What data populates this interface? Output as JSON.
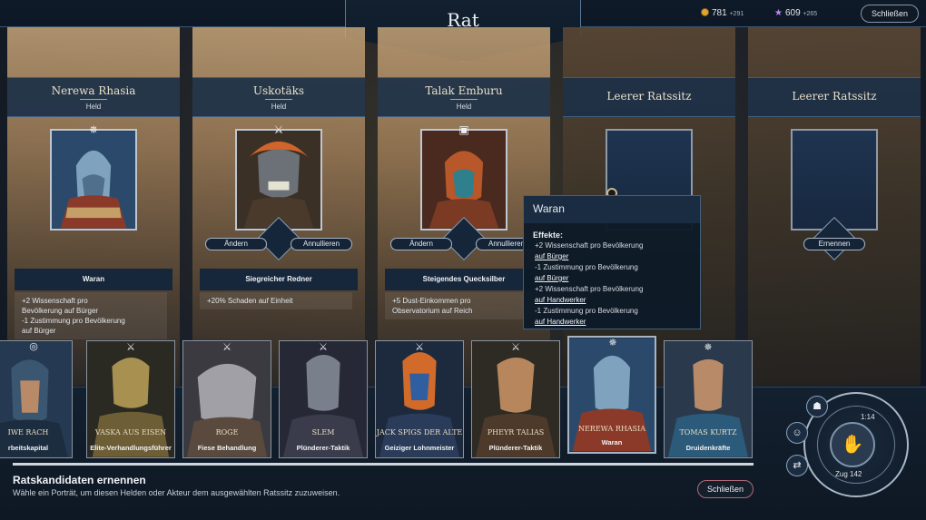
{
  "title": "Rat",
  "resources": {
    "gold": "781",
    "gold_delta": "+291",
    "influence": "609",
    "influence_delta": "+265",
    "close_label": "Schließen"
  },
  "council": [
    {
      "name": "Nerewa Rhasia",
      "subtitle": "Held",
      "ability": "Waran",
      "buttons": [],
      "effect": [
        "+2 Wissenschaft pro",
        "Bevölkerung auf Bürger",
        "-1 Zustimmung pro Bevölkerung",
        "auf Bürger"
      ]
    },
    {
      "name": "Uskotäks",
      "subtitle": "Held",
      "ability": "Siegreicher Redner",
      "buttons": [
        "Ändern",
        "Annullieren"
      ],
      "effect": [
        "+20% Schaden auf Einheit"
      ]
    },
    {
      "name": "Talak Emburu",
      "subtitle": "Held",
      "ability": "Steigendes Quecksilber",
      "buttons": [
        "Ändern",
        "Annullieren"
      ],
      "effect": [
        "+5 Dust-Einkommen pro",
        "Observatorium auf Reich"
      ]
    },
    {
      "name": "Leerer Ratssitz",
      "subtitle": "",
      "ability": "",
      "buttons": [],
      "effect": []
    },
    {
      "name": "Leerer Ratssitz",
      "subtitle": "",
      "ability": "",
      "buttons": [
        "Ernennen"
      ],
      "effect": []
    }
  ],
  "tooltip": {
    "title": "Waran",
    "effects_label": "Effekte:",
    "lines": [
      "+2 Wissenschaft pro Bevölkerung",
      "auf Bürger",
      "-1 Zustimmung pro Bevölkerung",
      "auf Bürger",
      "+2 Wissenschaft pro Bevölkerung",
      "auf Handwerker",
      "-1 Zustimmung pro Bevölkerung",
      "auf Handwerker"
    ]
  },
  "candidates": [
    {
      "name": "IWE RACH",
      "ability": "rbeitskapital",
      "icon": "coins-icon"
    },
    {
      "name": "VASKA AUS EISEN",
      "ability": "Elite-Verhandlungsführer",
      "icon": "crossed-swords-icon"
    },
    {
      "name": "ROGE",
      "ability": "Fiese Behandlung",
      "icon": "crossed-swords-icon"
    },
    {
      "name": "SLEM",
      "ability": "Plünderer-Taktik",
      "icon": "crossed-swords-icon"
    },
    {
      "name": "JACK SPIGS DER ALTE",
      "ability": "Geiziger Lohnmeister",
      "icon": "crossed-swords-icon"
    },
    {
      "name": "PHEYR TALIAS",
      "ability": "Plünderer-Taktik",
      "icon": "crossed-swords-icon"
    },
    {
      "name": "NEREWA RHASIA",
      "ability": "Waran",
      "icon": "compass-star-icon"
    },
    {
      "name": "TOMAS KURTZ",
      "ability": "Druidenkräfte",
      "icon": "compass-star-icon"
    }
  ],
  "bottom": {
    "title": "Ratskandidaten ernennen",
    "hint": "Wähle ein Porträt, um diesen Helden oder Akteur dem ausgewählten Ratssitz zuzuweisen.",
    "close_label": "Schließen"
  },
  "turn": {
    "number": "1:14",
    "label": "Zug 142"
  }
}
